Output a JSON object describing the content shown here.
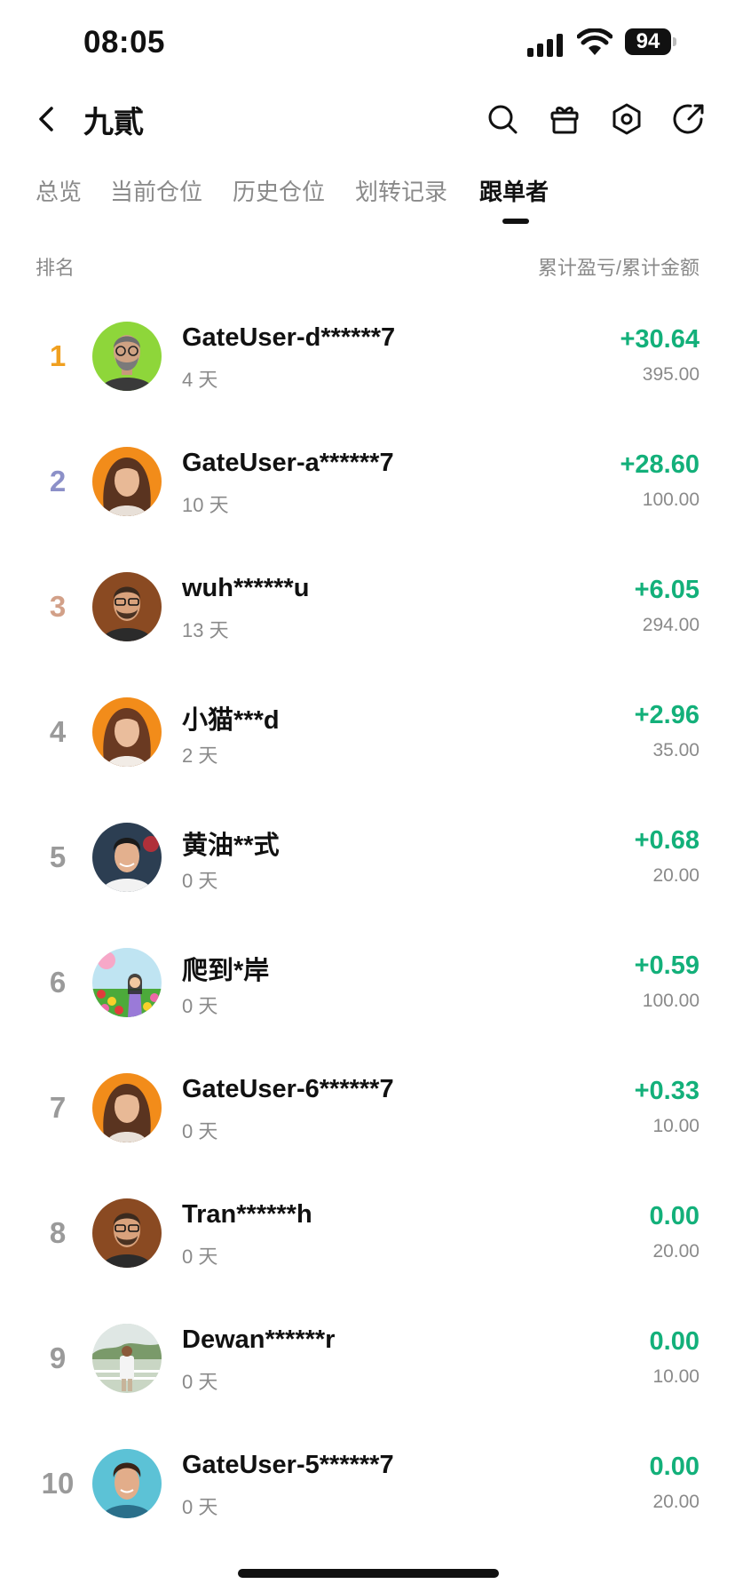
{
  "status_bar": {
    "time": "08:05",
    "battery": "94"
  },
  "header": {
    "title": "九貳"
  },
  "tabs": [
    {
      "label": "总览",
      "active": false
    },
    {
      "label": "当前仓位",
      "active": false
    },
    {
      "label": "历史仓位",
      "active": false
    },
    {
      "label": "划转记录",
      "active": false
    },
    {
      "label": "跟单者",
      "active": true
    }
  ],
  "table_header": {
    "left": "排名",
    "right": "累计盈亏/累计金额"
  },
  "colors": {
    "profit": "#13b07a",
    "rank_1": "#f0a020",
    "rank_2": "#8c90c8",
    "rank_3": "#d2a088",
    "rank_default": "#9a9a9a"
  },
  "followers": [
    {
      "rank": "1",
      "name": "GateUser-d******7",
      "days": "4 天",
      "pnl": "+30.64",
      "amount": "395.00"
    },
    {
      "rank": "2",
      "name": "GateUser-a******7",
      "days": "10 天",
      "pnl": "+28.60",
      "amount": "100.00"
    },
    {
      "rank": "3",
      "name": "wuh******u",
      "days": "13 天",
      "pnl": "+6.05",
      "amount": "294.00"
    },
    {
      "rank": "4",
      "name": "小猫***d",
      "days": "2 天",
      "pnl": "+2.96",
      "amount": "35.00"
    },
    {
      "rank": "5",
      "name": "黄油**式",
      "days": "0 天",
      "pnl": "+0.68",
      "amount": "20.00"
    },
    {
      "rank": "6",
      "name": "爬到*岸",
      "days": "0 天",
      "pnl": "+0.59",
      "amount": "100.00"
    },
    {
      "rank": "7",
      "name": "GateUser-6******7",
      "days": "0 天",
      "pnl": "+0.33",
      "amount": "10.00"
    },
    {
      "rank": "8",
      "name": "Tran******h",
      "days": "0 天",
      "pnl": "0.00",
      "amount": "20.00"
    },
    {
      "rank": "9",
      "name": "Dewan******r",
      "days": "0 天",
      "pnl": "0.00",
      "amount": "10.00"
    },
    {
      "rank": "10",
      "name": "GateUser-5******7",
      "days": "0 天",
      "pnl": "0.00",
      "amount": "20.00"
    }
  ]
}
